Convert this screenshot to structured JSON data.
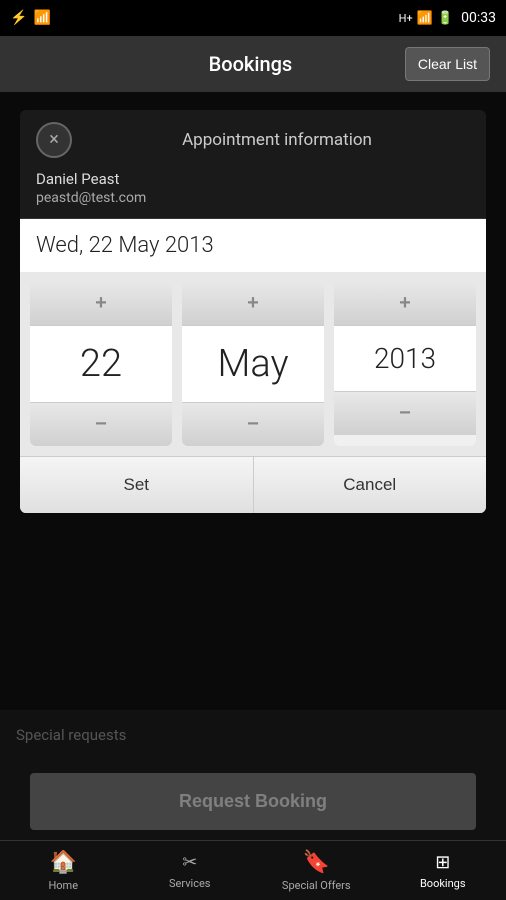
{
  "statusBar": {
    "time": "00:33",
    "leftIcons": [
      "usb",
      "wifi"
    ],
    "rightIcons": [
      "hplus",
      "signal",
      "battery"
    ]
  },
  "appBar": {
    "title": "Bookings",
    "clearListLabel": "Clear List"
  },
  "dialog": {
    "title": "Appointment information",
    "closeLabel": "×",
    "user": {
      "name": "Daniel Peast",
      "email": "peastd@test.com"
    },
    "datePicker": {
      "displayDate": "Wed, 22 May 2013",
      "day": "22",
      "month": "May",
      "year": "2013",
      "incrementLabel": "+",
      "decrementLabel": "−"
    },
    "setButton": "Set",
    "cancelButton": "Cancel"
  },
  "bottomContent": {
    "specialRequestsPlaceholder": "Special requests",
    "requestBookingLabel": "Request Booking"
  },
  "bottomNav": {
    "items": [
      {
        "id": "home",
        "label": "Home",
        "icon": "🏠"
      },
      {
        "id": "services",
        "label": "Services",
        "icon": "✂"
      },
      {
        "id": "special-offers",
        "label": "Special Offers",
        "icon": "🔖"
      },
      {
        "id": "bookings",
        "label": "Bookings",
        "icon": "▦"
      }
    ],
    "activeItem": "bookings"
  }
}
